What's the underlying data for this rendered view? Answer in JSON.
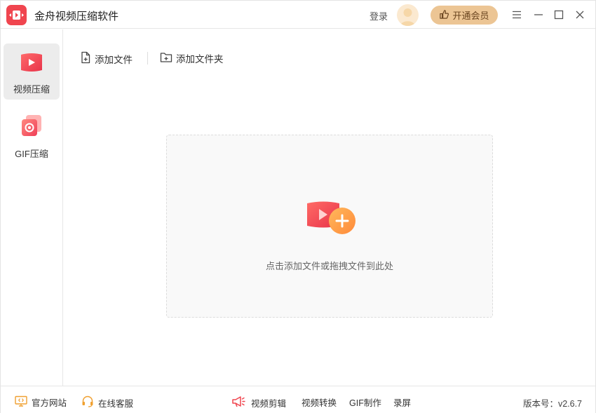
{
  "titlebar": {
    "app_title": "金舟视频压缩软件",
    "login_label": "登录",
    "vip_label": "开通会员",
    "icons": [
      "app-logo-icon",
      "avatar-icon",
      "thumb-up-icon",
      "menu-icon",
      "minimize-icon",
      "maximize-icon",
      "close-icon"
    ]
  },
  "sidebar": {
    "items": [
      {
        "label": "视频压缩",
        "icon": "video-compress-icon",
        "active": true
      },
      {
        "label": "GIF压缩",
        "icon": "gif-compress-icon",
        "active": false
      }
    ]
  },
  "toolbar": {
    "add_file_label": "添加文件",
    "add_folder_label": "添加文件夹"
  },
  "dropzone": {
    "hint": "点击添加文件或拖拽文件到此处",
    "icon": "add-video-icon"
  },
  "footer": {
    "official_site": "官方网站",
    "online_service": "在线客服",
    "video_edit": "视频剪辑",
    "video_convert": "视频转换",
    "gif_make": "GIF制作",
    "screen_record": "录屏",
    "version": "版本号：v2.6.7"
  },
  "colors": {
    "brand": "#f0454f",
    "vip_bg": "#ecc594",
    "accent_orange": "#ff9a4a"
  }
}
